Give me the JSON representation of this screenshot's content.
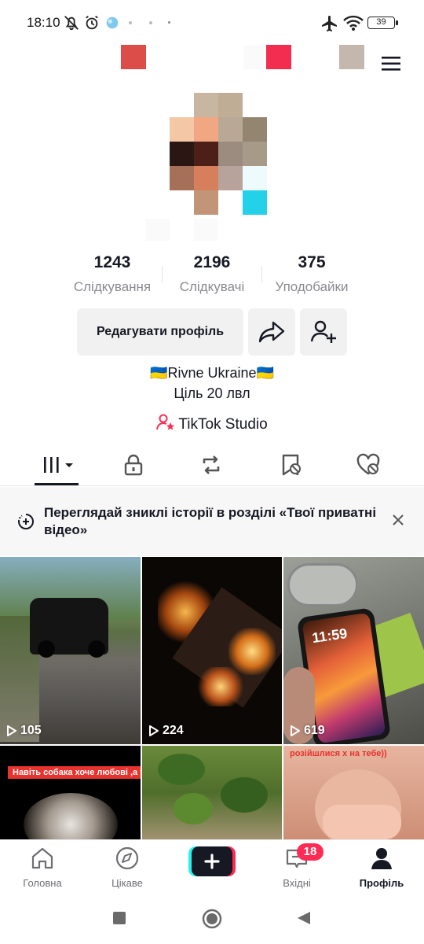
{
  "status_bar": {
    "time": "18:10",
    "battery": "39"
  },
  "profile": {
    "stats": [
      {
        "value": "1243",
        "label": "Слідкування"
      },
      {
        "value": "2196",
        "label": "Слідкувачі"
      },
      {
        "value": "375",
        "label": "Уподобайки"
      }
    ],
    "edit_button": "Редагувати профіль",
    "bio_line1": "🇺🇦Rivne Ukraine🇺🇦",
    "bio_line2": "Ціль 20 лвл",
    "studio_link": "TikTok Studio"
  },
  "banner": {
    "text": "Переглядай зниклі історії в розділі «Твої приватні відео»"
  },
  "videos": [
    {
      "views": "105"
    },
    {
      "views": "224"
    },
    {
      "views": "619",
      "phone_time": "11:59"
    },
    {
      "caption": "Навіть собака хоче любові ,а ти ні)"
    },
    {},
    {
      "caption": "розійшлися х на тебе))"
    }
  ],
  "bottom_nav": {
    "home": "Головна",
    "discover": "Цікаве",
    "inbox": "Вхідні",
    "inbox_badge": "18",
    "profile": "Профіль"
  },
  "colors": {
    "accent": "#fe2c55",
    "cyan": "#25f4ee",
    "text": "#161823",
    "muted": "#8a8b91"
  }
}
